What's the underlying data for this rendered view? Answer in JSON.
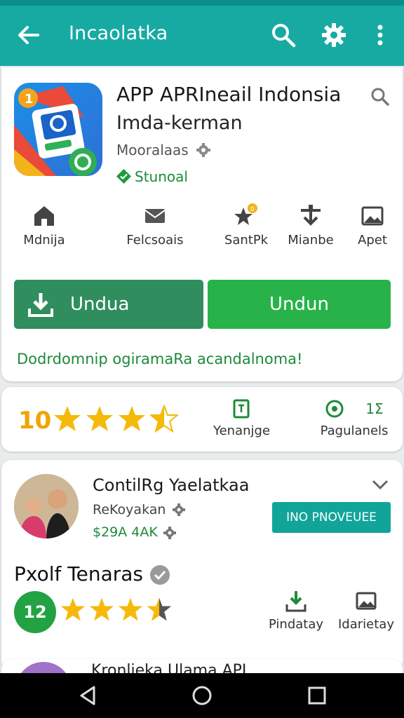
{
  "appbar": {
    "title": "Incaolatka",
    "back_icon": "arrow-left-icon",
    "actions": [
      "search-icon",
      "gear-icon",
      "more-vert-icon"
    ]
  },
  "app": {
    "name": "APP APRIneail Indonsia",
    "developer": "Imda-kerman",
    "category": "Mooralaas",
    "badge": "Stunoal"
  },
  "stats": [
    {
      "label": "Mdnija",
      "icon": "home-icon"
    },
    {
      "label": "Felcsoais",
      "icon": "mail-icon"
    },
    {
      "label": "SantPk",
      "icon": "star-badge-icon"
    },
    {
      "label": "Mianbe",
      "icon": "download-arrow-icon"
    },
    {
      "label": "Apet",
      "icon": "image-icon"
    }
  ],
  "buttons": {
    "primary": "Undua",
    "secondary": "Undun"
  },
  "promo": "Dodrdomnip ogiramaRa acandalnoma!",
  "rating": {
    "value": "10",
    "stars": 3.5,
    "mini": [
      {
        "label": "Yenanjge",
        "icon": "document-icon"
      },
      {
        "label": "Pagulanels",
        "icon": "circle-icon",
        "extra": "1Σ"
      }
    ]
  },
  "review": {
    "title": "ContilRg Yaelatkaa",
    "subtitle": "ReKoyakan",
    "amount": "$29A 4AK",
    "install_chip": "INO PNOVEUEE"
  },
  "section": {
    "title": "Pxolf Tenaras",
    "badge_number": "12",
    "stars": 3.5,
    "actions": [
      {
        "label": "Pindatay",
        "icon": "download-tray-icon"
      },
      {
        "label": "Idarietay",
        "icon": "image-frame-icon"
      }
    ]
  },
  "next_item": {
    "title": "Kronlieka Ulama API"
  },
  "colors": {
    "appbar": "#17aaa3",
    "primary_button": "#2f8d5e",
    "secondary_button": "#27b34a",
    "accent_green": "#1f8a3a",
    "star": "#f5b90a",
    "chip": "#11a59a"
  }
}
